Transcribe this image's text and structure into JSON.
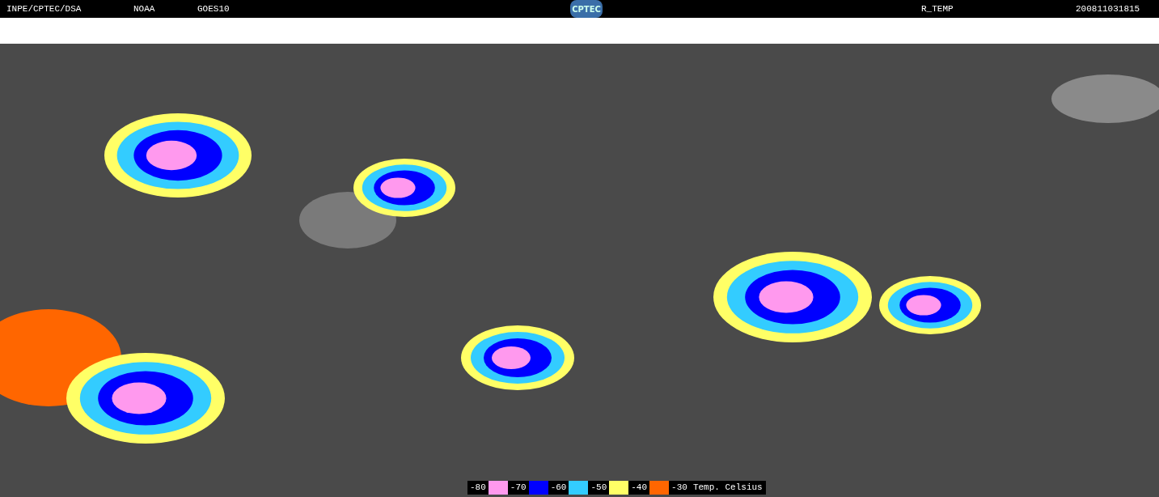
{
  "header": {
    "labels": [
      "INPE/CPTEC/DSA",
      "NOAA",
      "GOES10"
    ],
    "logo": "CPTEC",
    "product": "R_TEMP",
    "timestamp": "200811031815"
  },
  "legend": {
    "entries": [
      {
        "label": "-80",
        "color": "#ff99ee"
      },
      {
        "label": "-70",
        "color": "#0000ff"
      },
      {
        "label": "-60",
        "color": "#33ccff"
      },
      {
        "label": "-50",
        "color": "#ffff66"
      },
      {
        "label": "-40",
        "color": "#ff6600"
      },
      {
        "label": "-30"
      }
    ],
    "title": "Temp. Celsius"
  }
}
